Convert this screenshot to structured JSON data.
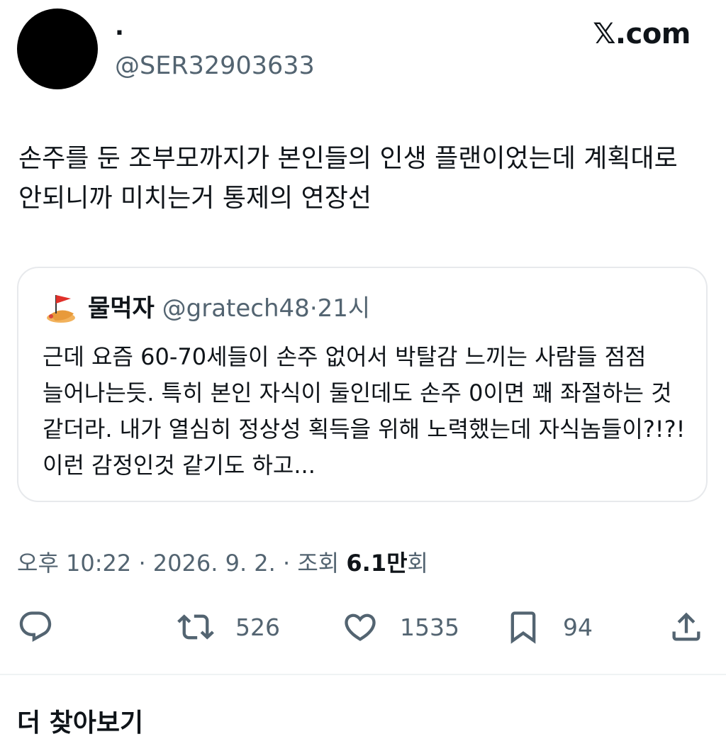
{
  "author": {
    "display_name": ".",
    "handle": "@SER32903633"
  },
  "brand": {
    "x_mark": "𝕏",
    "suffix": ".com"
  },
  "tweet": {
    "text": "손주를 둔 조부모까지가 본인들의 인생 플랜이었는데 계획대로 안되니까 미치는거 통제의 연장선"
  },
  "quote": {
    "avatar_icon": "flag-mascot-icon",
    "display_name": "물먹자",
    "handle": "@gratech48",
    "separator": "·",
    "time": "21시",
    "text": "근데 요즘 60-70세들이 손주 없어서 박탈감 느끼는 사람들 점점 늘어나는듯. 특히 본인 자식이 둘인데도 손주 0이면 꽤 좌절하는 것 같더라. 내가 열심히 정상성 획득을 위해 노력했는데 자식놈들이?!?! 이런 감정인것 같기도 하고..."
  },
  "meta": {
    "time": "오후 10:22",
    "sep1": " · ",
    "date": "2026. 9. 2.",
    "sep2": " · ",
    "views_label": "조회 ",
    "views_count": "6.1만",
    "views_unit": "회"
  },
  "actions": {
    "reply": {
      "icon": "reply-icon"
    },
    "retweet": {
      "icon": "retweet-icon",
      "count": "526"
    },
    "like": {
      "icon": "heart-icon",
      "count": "1535"
    },
    "bookmark": {
      "icon": "bookmark-icon",
      "count": "94"
    },
    "share": {
      "icon": "share-icon"
    }
  },
  "more_label": "더 찾아보기",
  "colors": {
    "text": "#0f1419",
    "secondary": "#536471",
    "border": "#e7e9ec"
  }
}
